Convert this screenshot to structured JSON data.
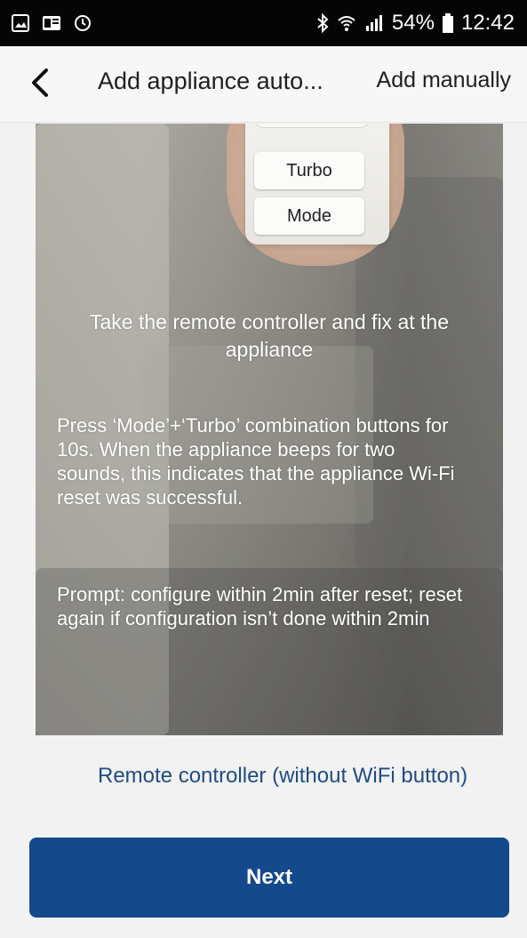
{
  "status_bar": {
    "battery_percent": "54%",
    "time": "12:42",
    "icons": {
      "left": [
        "gallery-icon",
        "outlook-icon",
        "sync-icon"
      ],
      "right": [
        "bluetooth-icon",
        "wifi-icon",
        "signal-icon",
        "battery-icon"
      ]
    }
  },
  "header": {
    "title": "Add appliance auto...",
    "action": "Add manually",
    "back_icon": "chevron-left-icon"
  },
  "illustration": {
    "remote_buttons": [
      "Turbo",
      "Mode"
    ]
  },
  "instructions": {
    "heading": "Take the remote controller and fix at the appliance",
    "body": "Press ‘Mode’+‘Turbo’ combination buttons for 10s. When the appliance beeps for two sounds, this indicates that the appliance Wi-Fi reset was successful.",
    "prompt": "Prompt: configure within 2min after reset; reset again if configuration isn’t done within 2min"
  },
  "links": {
    "remote_type": "Remote controller (without WiFi button)"
  },
  "buttons": {
    "next": "Next"
  },
  "colors": {
    "primary": "#14498c",
    "link": "#1f4c86",
    "status_bar": "#050505"
  }
}
